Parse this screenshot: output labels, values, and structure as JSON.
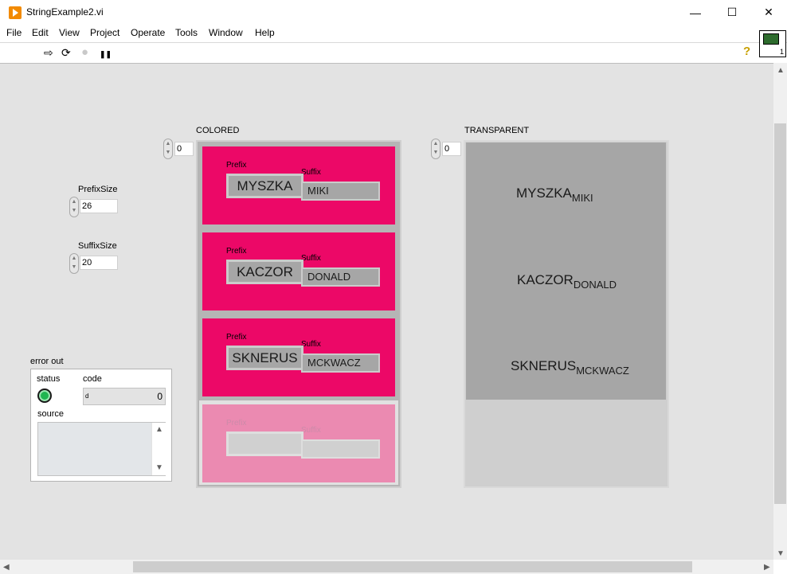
{
  "window": {
    "title": "StringExample2.vi",
    "minimize": "—",
    "maximize": "☐",
    "close": "✕"
  },
  "menu": [
    "File",
    "Edit",
    "View",
    "Project",
    "Operate",
    "Tools",
    "Window",
    "Help"
  ],
  "toolbar": {
    "run": "⇨",
    "run_continuous": "⟳",
    "abort": "●",
    "pause": "❚❚",
    "help": "?"
  },
  "vi_icon": {
    "connector_number": "1"
  },
  "controls": {
    "prefix_size": {
      "label": "PrefixSize",
      "value": "26"
    },
    "suffix_size": {
      "label": "SuffixSize",
      "value": "20"
    }
  },
  "colored_array": {
    "label": "COLORED",
    "index": "0",
    "elements": [
      {
        "prefix_label": "Prefix",
        "suffix_label": "Suffix",
        "prefix": "MYSZKA",
        "suffix": "MIKI"
      },
      {
        "prefix_label": "Prefix",
        "suffix_label": "Suffix",
        "prefix": "KACZOR",
        "suffix": "DONALD"
      },
      {
        "prefix_label": "Prefix",
        "suffix_label": "Suffix",
        "prefix": "SKNERUS",
        "suffix": "MCKWACZ"
      },
      {
        "prefix_label": "Prefix",
        "suffix_label": "Suffix",
        "prefix": "",
        "suffix": ""
      }
    ],
    "colors": {
      "element_bg": "#ec0867",
      "empty_bg": "#eb8ab1"
    }
  },
  "transparent_array": {
    "label": "TRANSPARENT",
    "index": "0",
    "elements": [
      {
        "prefix": "MYSZKA",
        "suffix": "MIKI"
      },
      {
        "prefix": "KACZOR",
        "suffix": "DONALD"
      },
      {
        "prefix": "SKNERUS",
        "suffix": "MCKWACZ"
      }
    ]
  },
  "error_out": {
    "label": "error out",
    "status_label": "status",
    "code_label": "code",
    "code_value": "0",
    "code_radix": "d",
    "source_label": "source",
    "source_value": "",
    "status_color": "#1fb550"
  }
}
